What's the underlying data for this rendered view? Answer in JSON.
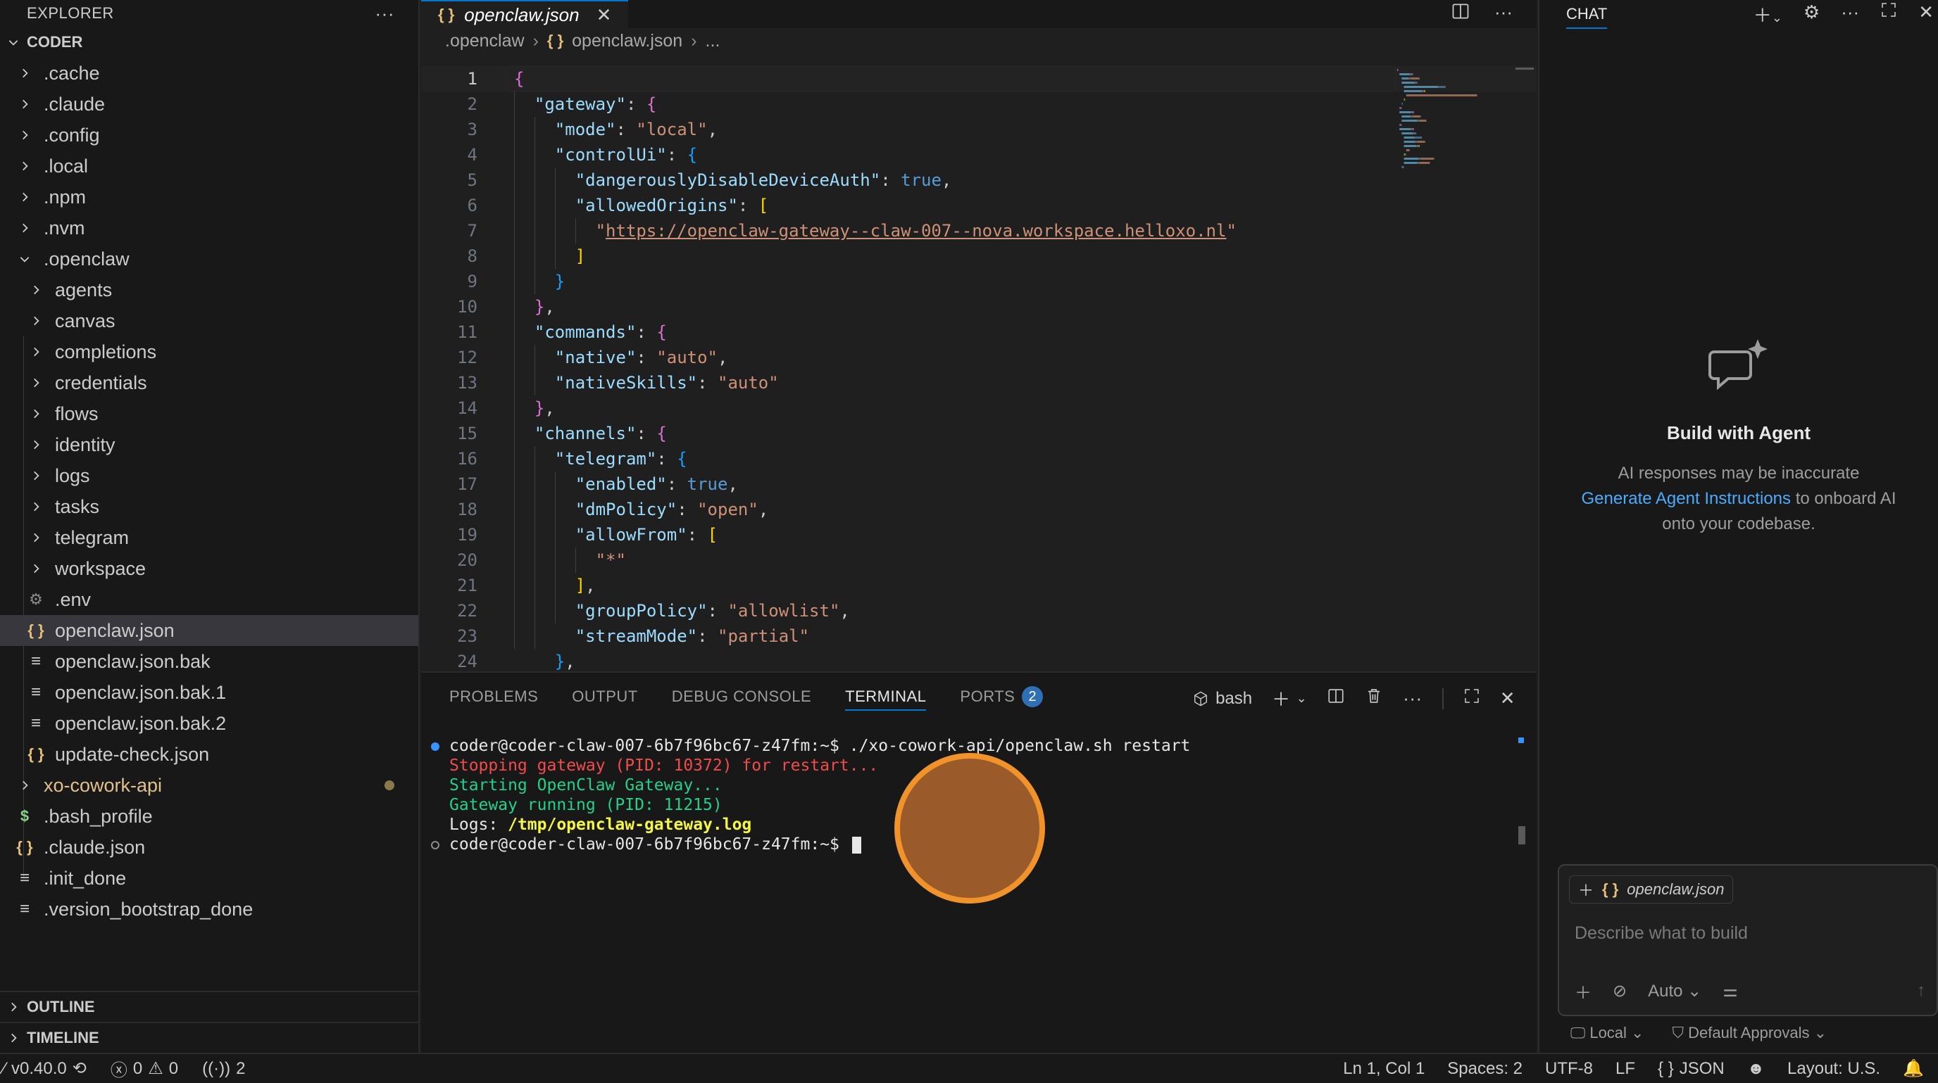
{
  "sidebar": {
    "title": "EXPLORER",
    "root": "CODER",
    "items": [
      {
        "label": ".cache",
        "type": "folder",
        "depth": 0,
        "icon": "chevron-right-icon"
      },
      {
        "label": ".claude",
        "type": "folder",
        "depth": 0,
        "icon": "chevron-right-icon"
      },
      {
        "label": ".config",
        "type": "folder",
        "depth": 0,
        "icon": "chevron-right-icon"
      },
      {
        "label": ".local",
        "type": "folder",
        "depth": 0,
        "icon": "chevron-right-icon"
      },
      {
        "label": ".npm",
        "type": "folder",
        "depth": 0,
        "icon": "chevron-right-icon"
      },
      {
        "label": ".nvm",
        "type": "folder",
        "depth": 0,
        "icon": "chevron-right-icon"
      },
      {
        "label": ".openclaw",
        "type": "folder-open",
        "depth": 0,
        "icon": "chevron-down-icon"
      },
      {
        "label": "agents",
        "type": "folder",
        "depth": 1,
        "icon": "chevron-right-icon"
      },
      {
        "label": "canvas",
        "type": "folder",
        "depth": 1,
        "icon": "chevron-right-icon"
      },
      {
        "label": "completions",
        "type": "folder",
        "depth": 1,
        "icon": "chevron-right-icon"
      },
      {
        "label": "credentials",
        "type": "folder",
        "depth": 1,
        "icon": "chevron-right-icon"
      },
      {
        "label": "flows",
        "type": "folder",
        "depth": 1,
        "icon": "chevron-right-icon"
      },
      {
        "label": "identity",
        "type": "folder",
        "depth": 1,
        "icon": "chevron-right-icon"
      },
      {
        "label": "logs",
        "type": "folder",
        "depth": 1,
        "icon": "chevron-right-icon"
      },
      {
        "label": "tasks",
        "type": "folder",
        "depth": 1,
        "icon": "chevron-right-icon"
      },
      {
        "label": "telegram",
        "type": "folder",
        "depth": 1,
        "icon": "chevron-right-icon"
      },
      {
        "label": "workspace",
        "type": "folder",
        "depth": 1,
        "icon": "chevron-right-icon"
      },
      {
        "label": ".env",
        "type": "file",
        "depth": 1,
        "icon": "gear-icon"
      },
      {
        "label": "openclaw.json",
        "type": "file",
        "depth": 1,
        "icon": "json-icon",
        "selected": true
      },
      {
        "label": "openclaw.json.bak",
        "type": "file",
        "depth": 1,
        "icon": "lines-icon"
      },
      {
        "label": "openclaw.json.bak.1",
        "type": "file",
        "depth": 1,
        "icon": "lines-icon"
      },
      {
        "label": "openclaw.json.bak.2",
        "type": "file",
        "depth": 1,
        "icon": "lines-icon"
      },
      {
        "label": "update-check.json",
        "type": "file",
        "depth": 1,
        "icon": "json-icon"
      },
      {
        "label": "xo-cowork-api",
        "type": "folder",
        "depth": 0,
        "icon": "chevron-right-icon",
        "modified": true
      },
      {
        "label": ".bash_profile",
        "type": "file",
        "depth": 0,
        "icon": "dollar-icon"
      },
      {
        "label": ".claude.json",
        "type": "file",
        "depth": 0,
        "icon": "json-icon"
      },
      {
        "label": ".init_done",
        "type": "file",
        "depth": 0,
        "icon": "lines-icon"
      },
      {
        "label": ".version_bootstrap_done",
        "type": "file",
        "depth": 0,
        "icon": "lines-icon"
      }
    ],
    "outline": "OUTLINE",
    "timeline": "TIMELINE"
  },
  "editor": {
    "tab_label": "openclaw.json",
    "breadcrumb": [
      ".openclaw",
      "openclaw.json",
      "..."
    ],
    "lines": [
      [
        [
          "p",
          "{"
        ]
      ],
      [
        [
          "t",
          "  "
        ],
        [
          "k",
          "\"gateway\""
        ],
        [
          "t",
          ": "
        ],
        [
          "p",
          "{"
        ]
      ],
      [
        [
          "t",
          "    "
        ],
        [
          "k",
          "\"mode\""
        ],
        [
          "t",
          ": "
        ],
        [
          "s",
          "\"local\""
        ],
        [
          "t",
          ","
        ]
      ],
      [
        [
          "t",
          "    "
        ],
        [
          "k",
          "\"controlUi\""
        ],
        [
          "t",
          ": "
        ],
        [
          "p2",
          "{"
        ]
      ],
      [
        [
          "t",
          "      "
        ],
        [
          "k",
          "\"dangerouslyDisableDeviceAuth\""
        ],
        [
          "t",
          ": "
        ],
        [
          "b",
          "true"
        ],
        [
          "t",
          ","
        ]
      ],
      [
        [
          "t",
          "      "
        ],
        [
          "k",
          "\"allowedOrigins\""
        ],
        [
          "t",
          ": "
        ],
        [
          "y",
          "["
        ]
      ],
      [
        [
          "t",
          "        "
        ],
        [
          "s",
          "\""
        ],
        [
          "u",
          "https://openclaw-gateway--claw-007--nova.workspace.helloxo.nl"
        ],
        [
          "s",
          "\""
        ]
      ],
      [
        [
          "t",
          "      "
        ],
        [
          "y",
          "]"
        ]
      ],
      [
        [
          "t",
          "    "
        ],
        [
          "p2",
          "}"
        ]
      ],
      [
        [
          "t",
          "  "
        ],
        [
          "p",
          "}"
        ],
        [
          "t",
          ","
        ]
      ],
      [
        [
          "t",
          "  "
        ],
        [
          "k",
          "\"commands\""
        ],
        [
          "t",
          ": "
        ],
        [
          "p",
          "{"
        ]
      ],
      [
        [
          "t",
          "    "
        ],
        [
          "k",
          "\"native\""
        ],
        [
          "t",
          ": "
        ],
        [
          "s",
          "\"auto\""
        ],
        [
          "t",
          ","
        ]
      ],
      [
        [
          "t",
          "    "
        ],
        [
          "k",
          "\"nativeSkills\""
        ],
        [
          "t",
          ": "
        ],
        [
          "s",
          "\"auto\""
        ]
      ],
      [
        [
          "t",
          "  "
        ],
        [
          "p",
          "}"
        ],
        [
          "t",
          ","
        ]
      ],
      [
        [
          "t",
          "  "
        ],
        [
          "k",
          "\"channels\""
        ],
        [
          "t",
          ": "
        ],
        [
          "p",
          "{"
        ]
      ],
      [
        [
          "t",
          "    "
        ],
        [
          "k",
          "\"telegram\""
        ],
        [
          "t",
          ": "
        ],
        [
          "p2",
          "{"
        ]
      ],
      [
        [
          "t",
          "      "
        ],
        [
          "k",
          "\"enabled\""
        ],
        [
          "t",
          ": "
        ],
        [
          "b",
          "true"
        ],
        [
          "t",
          ","
        ]
      ],
      [
        [
          "t",
          "      "
        ],
        [
          "k",
          "\"dmPolicy\""
        ],
        [
          "t",
          ": "
        ],
        [
          "s",
          "\"open\""
        ],
        [
          "t",
          ","
        ]
      ],
      [
        [
          "t",
          "      "
        ],
        [
          "k",
          "\"allowFrom\""
        ],
        [
          "t",
          ": "
        ],
        [
          "y",
          "["
        ]
      ],
      [
        [
          "t",
          "        "
        ],
        [
          "s",
          "\"*\""
        ]
      ],
      [
        [
          "t",
          "      "
        ],
        [
          "y",
          "]"
        ],
        [
          "t",
          ","
        ]
      ],
      [
        [
          "t",
          "      "
        ],
        [
          "k",
          "\"groupPolicy\""
        ],
        [
          "t",
          ": "
        ],
        [
          "s",
          "\"allowlist\""
        ],
        [
          "t",
          ","
        ]
      ],
      [
        [
          "t",
          "      "
        ],
        [
          "k",
          "\"streamMode\""
        ],
        [
          "t",
          ": "
        ],
        [
          "s",
          "\"partial\""
        ]
      ],
      [
        [
          "t",
          "    "
        ],
        [
          "p2",
          "}"
        ],
        [
          "t",
          ","
        ]
      ]
    ]
  },
  "panel": {
    "tabs": [
      "PROBLEMS",
      "OUTPUT",
      "DEBUG CONSOLE",
      "TERMINAL",
      "PORTS"
    ],
    "active_tab": "TERMINAL",
    "ports_badge": "2",
    "shell": "bash",
    "terminal": [
      {
        "marker": "blue",
        "cls": "t-white",
        "text": "coder@coder-claw-007-6b7f96bc67-z47fm:~$ ./xo-cowork-api/openclaw.sh restart"
      },
      {
        "marker": "",
        "cls": "t-red",
        "text": "Stopping gateway (PID: 10372) for restart..."
      },
      {
        "marker": "",
        "cls": "t-green",
        "text": "Starting OpenClaw Gateway..."
      },
      {
        "marker": "",
        "cls": "t-green",
        "text": "Gateway running (PID: 11215)"
      },
      {
        "marker": "",
        "cls": "t-mixed",
        "text": "Logs: ",
        "bold": "/tmp/openclaw-gateway.log"
      },
      {
        "marker": "hollow",
        "cls": "t-white",
        "text": "coder@coder-claw-007-6b7f96bc67-z47fm:~$ ",
        "cursor": true
      }
    ]
  },
  "chat": {
    "title": "CHAT",
    "welcome_title": "Build with Agent",
    "welcome_line1": "AI responses may be inaccurate",
    "welcome_link": "Generate Agent Instructions",
    "welcome_line2_rest": " to onboard AI",
    "welcome_line3": "onto your codebase.",
    "context_file": "openclaw.json",
    "input_placeholder": "Describe what to build",
    "mode_label": "Auto",
    "footer_location": "Local",
    "footer_approvals": "Default Approvals"
  },
  "statusbar": {
    "version": "v0.40.0",
    "errors": "0",
    "warnings": "0",
    "ports": "2",
    "position": "Ln 1, Col 1",
    "spaces": "Spaces: 2",
    "encoding": "UTF-8",
    "eol": "LF",
    "language": "JSON",
    "layout": "Layout: U.S."
  },
  "colors": {
    "accent": "#0078d4",
    "background": "#1f1f1f",
    "sidebar": "#181818",
    "click_marker": "#f0932b"
  }
}
